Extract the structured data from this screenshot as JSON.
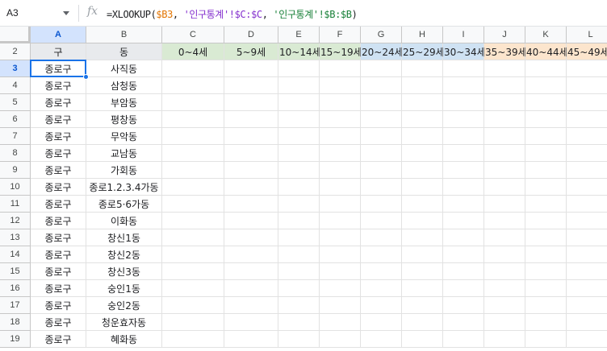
{
  "name_box": "A3",
  "formula": {
    "prefix": "=XLOOKUP(",
    "arg1": "$B3",
    "sep1": ", ",
    "arg2": "'인구통계'!$C:$C",
    "sep2": ", ",
    "arg3": "'인구통계'!$B:$B",
    "suffix": ")"
  },
  "columns": [
    "A",
    "B",
    "C",
    "D",
    "E",
    "F",
    "G",
    "H",
    "I",
    "J",
    "K",
    "L"
  ],
  "header_row": {
    "row_number": "2",
    "gu": "구",
    "dong": "동",
    "age_groups": [
      "0~4세",
      "5~9세",
      "10~14세",
      "15~19세",
      "20~24세",
      "25~29세",
      "30~34세",
      "35~39세",
      "40~44세",
      "45~49세"
    ]
  },
  "rows": [
    {
      "n": "3",
      "gu": "종로구",
      "dong": "사직동"
    },
    {
      "n": "4",
      "gu": "종로구",
      "dong": "삼청동"
    },
    {
      "n": "5",
      "gu": "종로구",
      "dong": "부암동"
    },
    {
      "n": "6",
      "gu": "종로구",
      "dong": "평창동"
    },
    {
      "n": "7",
      "gu": "종로구",
      "dong": "무악동"
    },
    {
      "n": "8",
      "gu": "종로구",
      "dong": "교남동"
    },
    {
      "n": "9",
      "gu": "종로구",
      "dong": "가회동"
    },
    {
      "n": "10",
      "gu": "종로구",
      "dong": "종로1.2.3.4가동"
    },
    {
      "n": "11",
      "gu": "종로구",
      "dong": "종로5·6가동"
    },
    {
      "n": "12",
      "gu": "종로구",
      "dong": "이화동"
    },
    {
      "n": "13",
      "gu": "종로구",
      "dong": "창신1동"
    },
    {
      "n": "14",
      "gu": "종로구",
      "dong": "창신2동"
    },
    {
      "n": "15",
      "gu": "종로구",
      "dong": "창신3동"
    },
    {
      "n": "16",
      "gu": "종로구",
      "dong": "숭인1동"
    },
    {
      "n": "17",
      "gu": "종로구",
      "dong": "숭인2동"
    },
    {
      "n": "18",
      "gu": "종로구",
      "dong": "청운효자동"
    },
    {
      "n": "19",
      "gu": "종로구",
      "dong": "혜화동"
    }
  ],
  "colors": {
    "selection": "#1a73e8",
    "age_green": "#d9ead3",
    "age_blue": "#cfe2f3",
    "age_orange": "#fce5cd",
    "header_gray": "#e8eaed"
  },
  "age_group_colors": [
    "green",
    "green",
    "green",
    "green",
    "blue",
    "blue",
    "blue",
    "orange",
    "orange",
    "orange"
  ],
  "icons": {
    "name_box_dropdown": "chevron-down-icon",
    "formula_function": "fx-icon"
  }
}
